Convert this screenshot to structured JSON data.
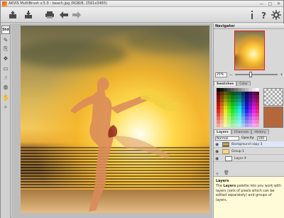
{
  "window": {
    "title": "AKVIS MultiBrush v.5.0 - beach.jpg (RGB/8, 2561x3465)",
    "controls": [
      "—",
      "□",
      "✕"
    ]
  },
  "toolbar": {
    "left_icons": [
      "open-icon",
      "save-icon",
      "print-icon",
      "undo-icon",
      "redo-icon"
    ],
    "right_icons": [
      "info-icon",
      "help-icon",
      "settings-icon"
    ]
  },
  "tools": {
    "selected_label": "Std",
    "items": [
      "brush-icon",
      "clone-icon",
      "chameleon-icon",
      "eraser-icon",
      "smudge-icon",
      "blur-icon",
      "hand-icon",
      "zoom-icon"
    ]
  },
  "navigator": {
    "title": "Navigator",
    "zoom": "25%"
  },
  "swatches": {
    "tabs": [
      "Swatches",
      "Color"
    ],
    "active_tab": "Swatches",
    "selected_color": "#b5673c"
  },
  "layers": {
    "tabs": [
      "Layers",
      "Channels",
      "History"
    ],
    "active_tab": "Layers",
    "blend_mode": "Normal",
    "opacity_label": "Opacity:",
    "opacity_value": "100",
    "items": [
      {
        "name": "Background copy 3"
      },
      {
        "name": "Group 1"
      },
      {
        "name": "Layer 4"
      }
    ]
  },
  "help": {
    "title": "Layers",
    "text_before": "The",
    "keyword": "Layers",
    "text_after": "palette lets you work with layers (sets of pixels which can be edited separately) and groups of layers."
  }
}
